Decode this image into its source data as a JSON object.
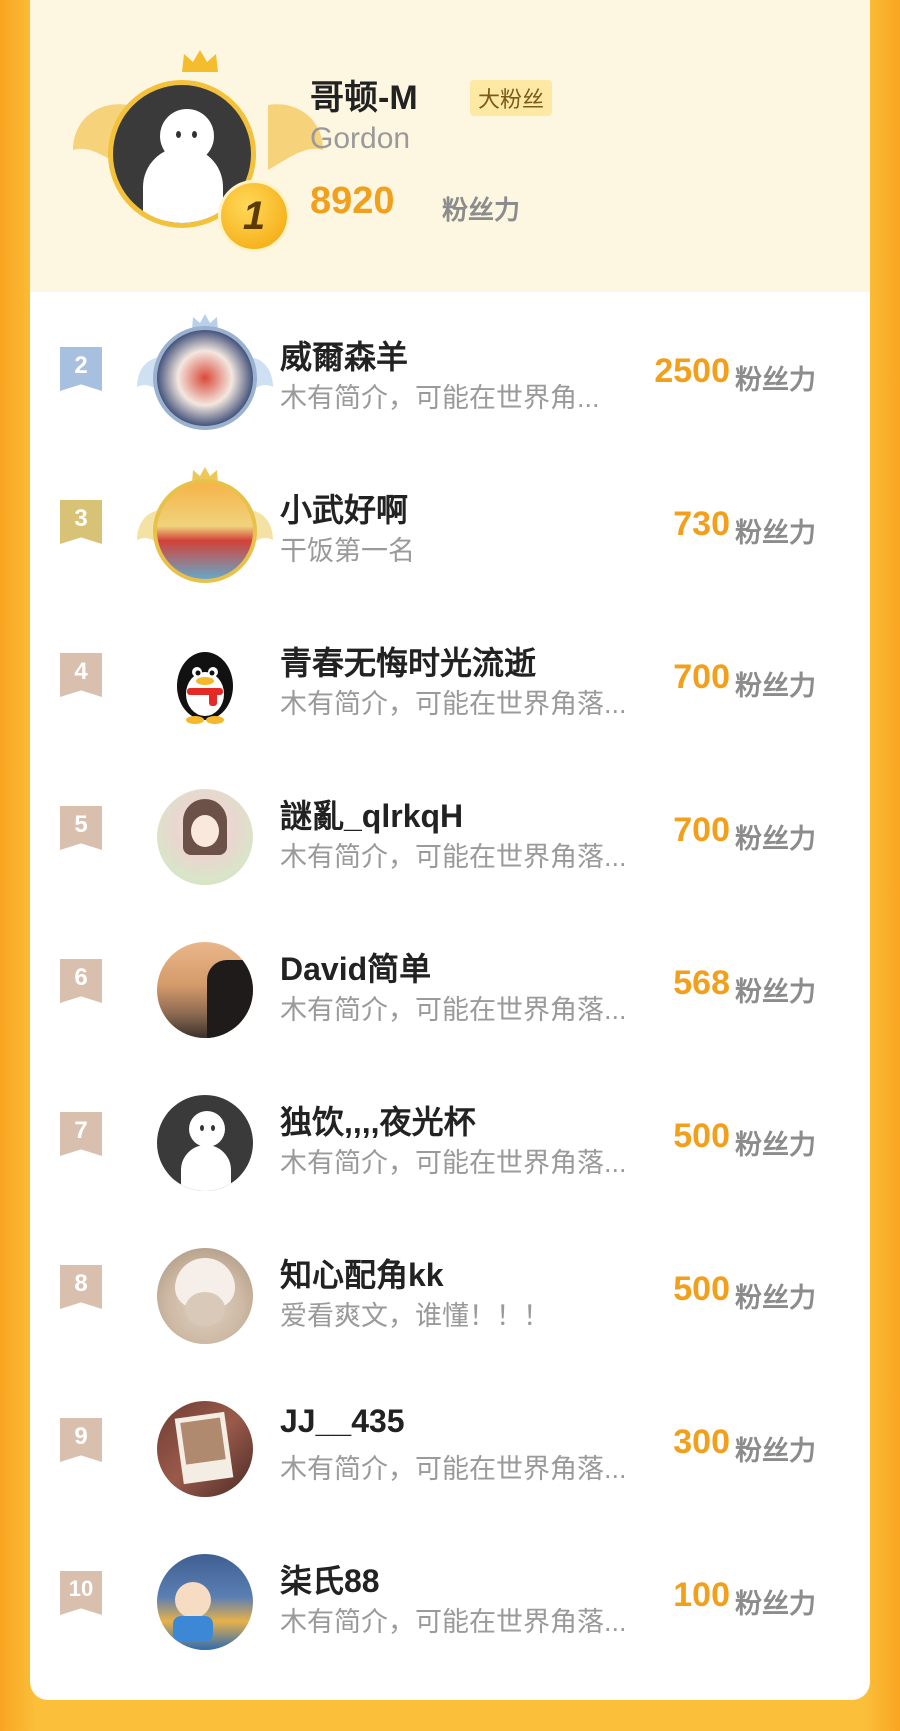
{
  "top": {
    "rank": "1",
    "name": "哥顿-M",
    "tag": "大粉丝",
    "subtitle": "Gordon",
    "score": "8920",
    "unit": "粉丝力"
  },
  "rows": [
    {
      "rank": "2",
      "name": "威爾森羊",
      "bio": "木有简介，可能在世界角...",
      "score": "2500",
      "unit": "粉丝力",
      "flag_color": "#a8c0df"
    },
    {
      "rank": "3",
      "name": "小武好啊",
      "bio": "干饭第一名",
      "score": "730",
      "unit": "粉丝力",
      "flag_color": "#d8c275"
    },
    {
      "rank": "4",
      "name": "青春无悔时光流逝",
      "bio": "木有简介，可能在世界角落...",
      "score": "700",
      "unit": "粉丝力",
      "flag_color": "#d9bfae"
    },
    {
      "rank": "5",
      "name": "謎亂_qlrkqH",
      "bio": "木有简介，可能在世界角落...",
      "score": "700",
      "unit": "粉丝力",
      "flag_color": "#d9bfae"
    },
    {
      "rank": "6",
      "name": "David简单",
      "bio": "木有简介，可能在世界角落...",
      "score": "568",
      "unit": "粉丝力",
      "flag_color": "#d9bfae"
    },
    {
      "rank": "7",
      "name": "独饮,,,,夜光杯",
      "bio": "木有简介，可能在世界角落...",
      "score": "500",
      "unit": "粉丝力",
      "flag_color": "#d9bfae"
    },
    {
      "rank": "8",
      "name": "知心配角kk",
      "bio": "爱看爽文，谁懂！！！",
      "score": "500",
      "unit": "粉丝力",
      "flag_color": "#d9bfae"
    },
    {
      "rank": "9",
      "name": "JJ__435",
      "bio": "木有简介，可能在世界角落...",
      "score": "300",
      "unit": "粉丝力",
      "flag_color": "#d9bfae"
    },
    {
      "rank": "10",
      "name": "柒氏88",
      "bio": "木有简介，可能在世界角落...",
      "score": "100",
      "unit": "粉丝力",
      "flag_color": "#d9bfae"
    }
  ],
  "colors": {
    "accent": "#f2a01c",
    "background": "#fbbf3a",
    "top_bg": "#fdf6e1"
  }
}
